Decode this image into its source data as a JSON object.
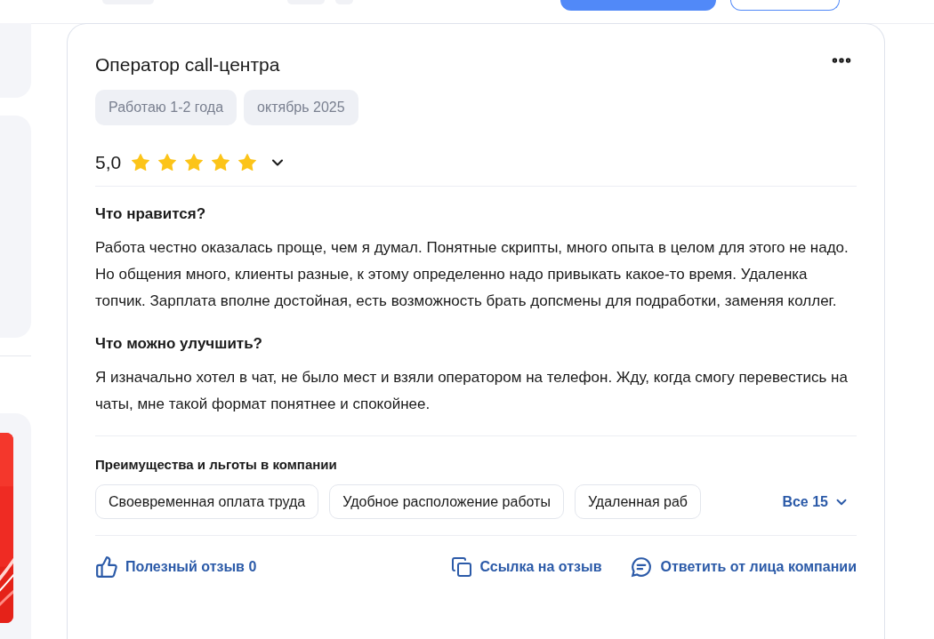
{
  "review": {
    "title": "Оператор call-центра",
    "tags": [
      "Работаю 1-2 года",
      "октябрь 2025"
    ],
    "rating": "5,0",
    "stars": 5,
    "sections": [
      {
        "heading": "Что нравится?",
        "text": "Работа честно оказалась проще, чем я думал. Понятные скрипты, много опыта в целом для этого не надо. Но общения много, клиенты разные, к этому определенно надо привыкать какое-то время. Удаленка топчик. Зарплата вполне достойная, есть возможность брать допсмены для подработки, заменяя коллег."
      },
      {
        "heading": "Что можно улучшить?",
        "text": "Я изначально хотел в чат, не было мест и взяли оператором на телефон. Жду, когда смогу перевестись на чаты, мне такой формат понятнее и спокойнее."
      }
    ],
    "benefits": {
      "heading": "Преимущества и льготы в компании",
      "items": [
        "Своевременная оплата труда",
        "Удобное расположение работы",
        "Удаленная раб"
      ],
      "more": "Все 15"
    },
    "actions": [
      {
        "kind": "like",
        "label": "Полезный отзыв 0"
      },
      {
        "kind": "link",
        "label": "Ссылка на отзыв"
      },
      {
        "kind": "reply",
        "label": "Ответить от лица компании"
      }
    ]
  }
}
